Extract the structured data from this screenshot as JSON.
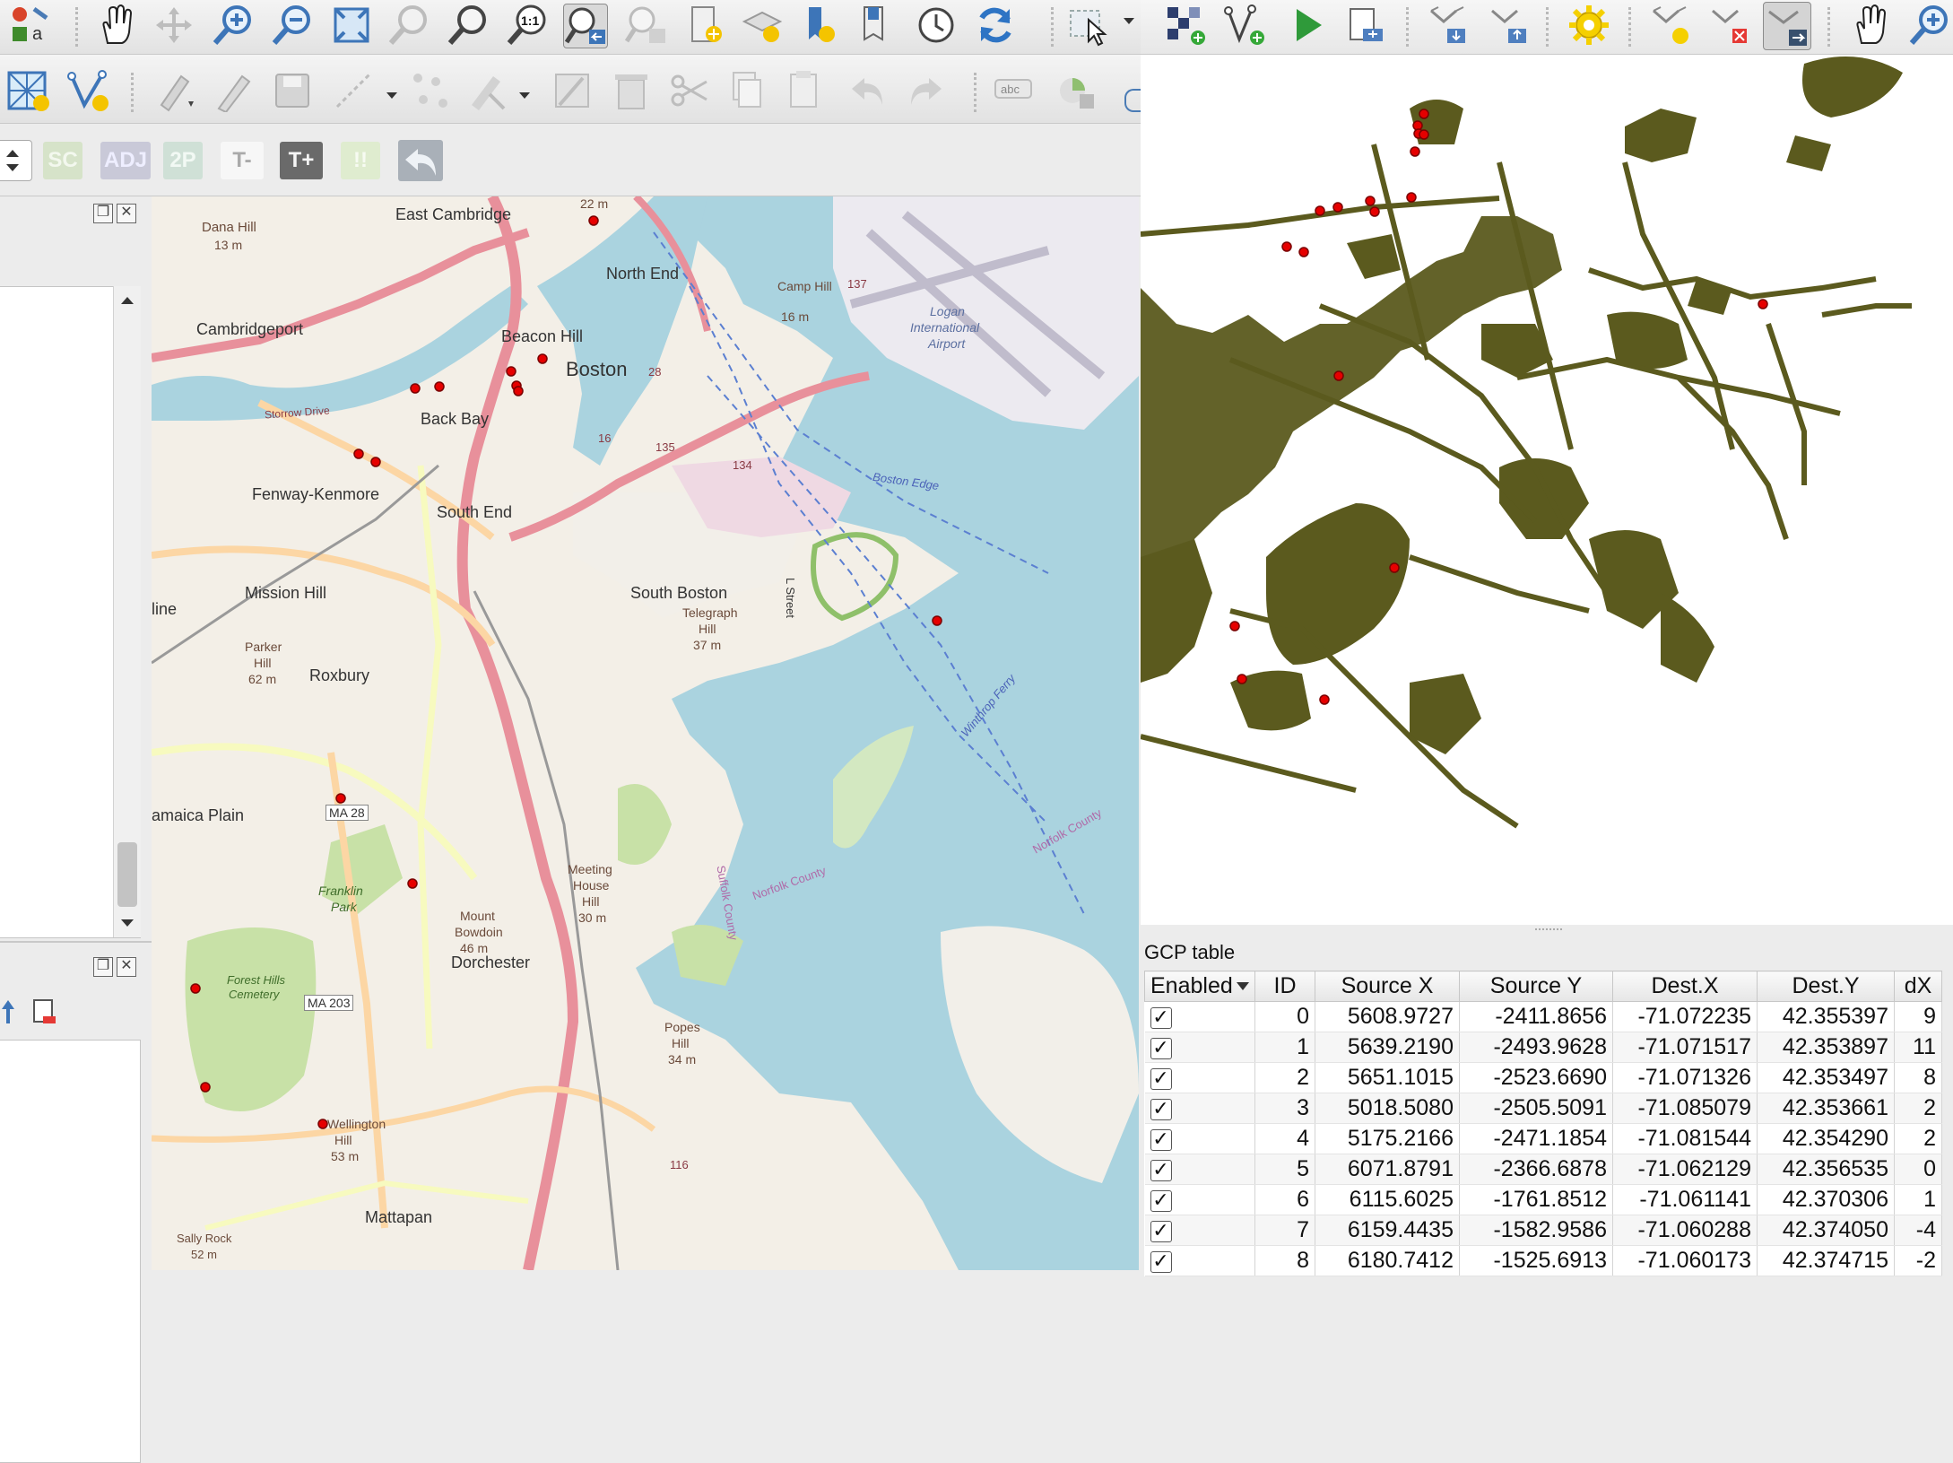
{
  "icons": {
    "main_toolbar": [
      "layer-style-icon",
      "pan-hand-icon",
      "pan-to-selection-icon",
      "zoom-in-icon",
      "zoom-out-icon",
      "zoom-full-icon",
      "zoom-to-selection-icon",
      "zoom-to-layer-icon",
      "zoom-native-icon",
      "zoom-last-icon",
      "zoom-next-icon",
      "new-bookmark-icon",
      "show-bookmarks-icon",
      "temporal-controller-icon",
      "refresh-icon",
      "select-feature-icon"
    ],
    "georef_toolbar": [
      "add-raster-icon",
      "add-point-icon",
      "start-georeferencing-icon",
      "generate-gdal-script-icon",
      "load-gcp-icon",
      "save-gcp-icon",
      "transformation-settings-icon",
      "add-gcp-point-icon",
      "delete-gcp-point-icon",
      "move-gcp-point-icon",
      "georef-pan-icon",
      "georef-zoom-in-icon"
    ],
    "digitizing_toolbar": [
      "new-layer-icon",
      "new-vertex-layer-icon",
      "current-edits-icon",
      "toggle-editing-icon",
      "save-edits-icon",
      "digitize-icon",
      "vertex-tool-icon",
      "modify-attributes-icon",
      "delete-selected-icon",
      "cut-features-icon",
      "copy-features-icon",
      "paste-features-icon",
      "undo-icon",
      "redo-icon",
      "label-abc-icon",
      "diagram-icon"
    ]
  },
  "adv_toolbar": {
    "sc": "SC",
    "adj": "ADJ",
    "tp": "2P",
    "tminus": "T-",
    "tplus": "T+",
    "pause": "!!"
  },
  "map_labels": {
    "east_cambridge": "East Cambridge",
    "dana_hill": "Dana Hill",
    "dana_hill_elev": "13 m",
    "cambridgeport": "Cambridgeport",
    "north_end": "North End",
    "camp_hill": "Camp Hill",
    "camp_hill_elev": "16 m",
    "logan": "Logan",
    "logan2": "International",
    "logan3": "Airport",
    "beacon_hill": "Beacon Hill",
    "boston": "Boston",
    "back_bay": "Back Bay",
    "storrow": "Storrow Drive",
    "fenway": "Fenway-Kenmore",
    "south_end": "South End",
    "mission_hill": "Mission Hill",
    "south_boston": "South Boston",
    "telegraph": "Telegraph",
    "telegraph_hill": "Hill",
    "telegraph_elev": "37 m",
    "line": "line",
    "parker": "Parker",
    "parker_hill": "Hill",
    "parker_elev": "62 m",
    "roxbury": "Roxbury",
    "jamaica": "amaica Plain",
    "ma28": "MA 28",
    "franklin": "Franklin",
    "franklin2": "Park",
    "meeting": "Meeting",
    "meeting2": "House",
    "meeting3": "Hill",
    "meeting_elev": "30 m",
    "mount_bowdoin": "Mount",
    "mount_bowdoin2": "Bowdoin",
    "mount_bowdoin_elev": "46 m",
    "dorchester": "Dorchester",
    "forest_hills": "Forest Hills",
    "forest_hills2": "Cemetery",
    "ma203": "MA 203",
    "popes": "Popes",
    "popes2": "Hill",
    "popes_elev": "34 m",
    "wellington": "Wellington",
    "wellington2": "Hill",
    "wellington_elev": "53 m",
    "mattapan": "Mattapan",
    "sally_rock": "Sally Rock",
    "sally_rock_elev": "52 m",
    "boston_edge": "Boston Edge",
    "norfolk_county": "Norfolk County",
    "norfolk_county2": "Norfolk County",
    "suffolk_county": "Suffolk County",
    "l_street": "L Street",
    "winthrop": "Winthrop Ferry",
    "r135": "135",
    "r134": "134",
    "r137": "137",
    "r22m": "22 m",
    "r28": "28",
    "r16": "16",
    "r116": "116"
  },
  "gcp_table": {
    "title": "GCP table",
    "columns": [
      "Enabled",
      "ID",
      "Source X",
      "Source Y",
      "Dest.X",
      "Dest.Y",
      "dX"
    ],
    "rows": [
      {
        "enabled": "✓",
        "id": "0",
        "sx": "5608.9727",
        "sy": "-2411.8656",
        "dx": "-71.072235",
        "dy": "42.355397",
        "ddx": "9"
      },
      {
        "enabled": "✓",
        "id": "1",
        "sx": "5639.2190",
        "sy": "-2493.9628",
        "dx": "-71.071517",
        "dy": "42.353897",
        "ddx": "11"
      },
      {
        "enabled": "✓",
        "id": "2",
        "sx": "5651.1015",
        "sy": "-2523.6690",
        "dx": "-71.071326",
        "dy": "42.353497",
        "ddx": "8"
      },
      {
        "enabled": "✓",
        "id": "3",
        "sx": "5018.5080",
        "sy": "-2505.5091",
        "dx": "-71.085079",
        "dy": "42.353661",
        "ddx": "2"
      },
      {
        "enabled": "✓",
        "id": "4",
        "sx": "5175.2166",
        "sy": "-2471.1854",
        "dx": "-71.081544",
        "dy": "42.354290",
        "ddx": "2"
      },
      {
        "enabled": "✓",
        "id": "5",
        "sx": "6071.8791",
        "sy": "-2366.6878",
        "dx": "-71.062129",
        "dy": "42.356535",
        "ddx": "0"
      },
      {
        "enabled": "✓",
        "id": "6",
        "sx": "6115.6025",
        "sy": "-1761.8512",
        "dx": "-71.061141",
        "dy": "42.370306",
        "ddx": "1"
      },
      {
        "enabled": "✓",
        "id": "7",
        "sx": "6159.4435",
        "sy": "-1582.9586",
        "dx": "-71.060288",
        "dy": "42.374050",
        "ddx": "-4"
      },
      {
        "enabled": "✓",
        "id": "8",
        "sx": "6180.7412",
        "sy": "-1525.6913",
        "dx": "-71.060173",
        "dy": "42.374715",
        "ddx": "-2"
      }
    ]
  },
  "colors": {
    "raster_fill": "#5b5a1e",
    "gcp_point": "#e60000",
    "water": "#aad3df",
    "park": "#c8e1a7",
    "land": "#f2efe9"
  }
}
